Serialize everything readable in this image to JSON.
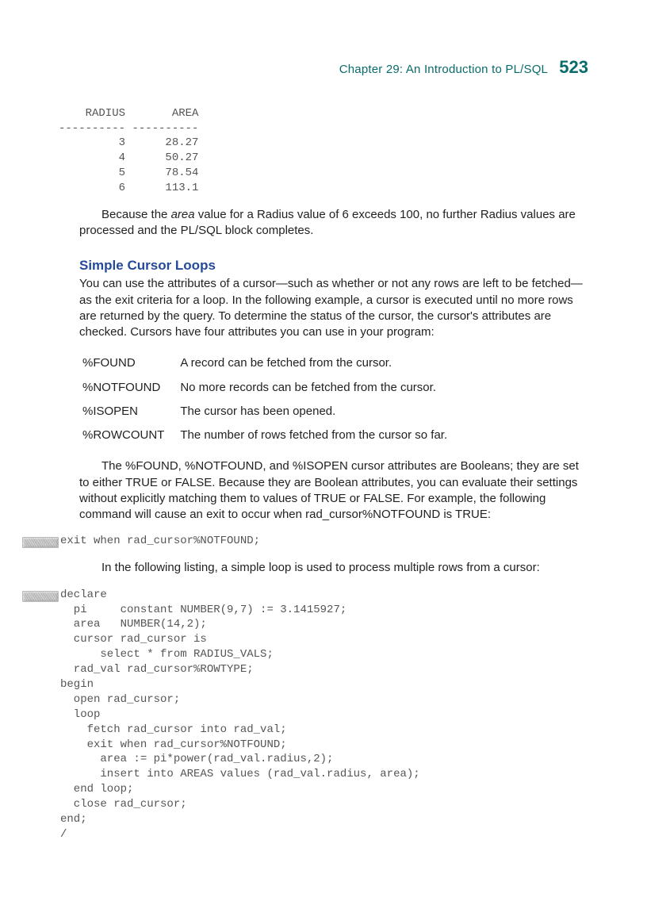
{
  "header": {
    "chapter": "Chapter 29:   An Introduction to PL/SQL",
    "page": "523"
  },
  "table_output": "    RADIUS       AREA\n---------- ----------\n         3      28.27\n         4      50.27\n         5      78.54\n         6      113.1",
  "para1_a": "Because the ",
  "para1_area": "area",
  "para1_b": " value for a Radius value of 6 exceeds 100, no further Radius values are processed and the PL/SQL block completes.",
  "h2": "Simple Cursor Loops",
  "para2": "You can use the attributes of a cursor—such as whether or not any rows are left to be fetched—as the exit criteria for a loop. In the following example, a cursor is executed until no more rows are returned by the query. To determine the status of the cursor, the cursor's attributes are checked. Cursors have four attributes you can use in your program:",
  "attrs": [
    {
      "key": "%FOUND",
      "desc": "A record can be fetched from the cursor."
    },
    {
      "key": "%NOTFOUND",
      "desc": "No more records can be fetched from the cursor."
    },
    {
      "key": "%ISOPEN",
      "desc": "The cursor has been opened."
    },
    {
      "key": "%ROWCOUNT",
      "desc": "The number of rows fetched from the cursor so far."
    }
  ],
  "para3": "The %FOUND, %NOTFOUND, and %ISOPEN cursor attributes are Booleans; they are set to either TRUE or FALSE. Because they are Boolean attributes, you can evaluate their settings without explicitly matching them to values of TRUE or FALSE. For example, the following command will cause an exit to occur when rad_cursor%NOTFOUND is TRUE:",
  "code1": "exit when rad_cursor%NOTFOUND;",
  "para4": "In the following listing, a simple loop is used to process multiple rows from a cursor:",
  "code2": "declare\n  pi     constant NUMBER(9,7) := 3.1415927;\n  area   NUMBER(14,2);\n  cursor rad_cursor is\n      select * from RADIUS_VALS;\n  rad_val rad_cursor%ROWTYPE;\nbegin\n  open rad_cursor;\n  loop\n    fetch rad_cursor into rad_val;\n    exit when rad_cursor%NOTFOUND;\n      area := pi*power(rad_val.radius,2);\n      insert into AREAS values (rad_val.radius, area);\n  end loop;\n  close rad_cursor;\nend;\n/"
}
